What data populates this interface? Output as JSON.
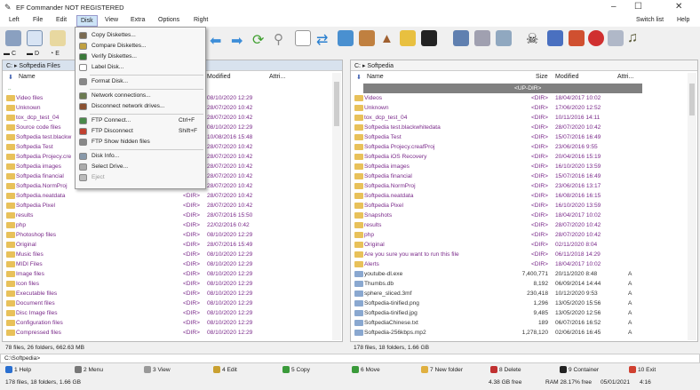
{
  "window": {
    "title": "EF Commander NOT REGISTERED",
    "minimize": "–",
    "maximize": "☐",
    "close": "✕"
  },
  "menubar": {
    "items": [
      "Left",
      "File",
      "Edit",
      "Disk",
      "View",
      "Extra",
      "Options",
      "Right"
    ],
    "switch_list": "Switch list",
    "help": "Help"
  },
  "drives": [
    "C",
    "D",
    "E"
  ],
  "disk_menu": [
    {
      "label": "Copy Diskettes...",
      "disabled": false
    },
    {
      "label": "Compare Diskettes...",
      "disabled": false
    },
    {
      "label": "Verify Diskettes...",
      "disabled": false
    },
    {
      "label": "Label Disk...",
      "disabled": false
    },
    {
      "label": "Format Disk...",
      "disabled": false,
      "sep_before": true
    },
    {
      "label": "Network connections...",
      "disabled": false,
      "sep_before": true
    },
    {
      "label": "Disconnect network drives...",
      "disabled": false
    },
    {
      "label": "FTP Connect...",
      "shortcut": "Ctrl+F",
      "disabled": false,
      "sep_before": true
    },
    {
      "label": "FTP Disconnect",
      "shortcut": "Shift+F",
      "disabled": false
    },
    {
      "label": "FTP Show hidden files",
      "disabled": false
    },
    {
      "label": "Disk Info...",
      "disabled": false,
      "sep_before": true
    },
    {
      "label": "Select Drive...",
      "disabled": false
    },
    {
      "label": "Eject",
      "disabled": true
    }
  ],
  "left_pane": {
    "path": "C: ▸ Softpedia Files",
    "columns": {
      "name": "Name",
      "modified": "Modified",
      "attr": "Attri..."
    },
    "parent": "..",
    "rows": [
      [
        "Video files",
        "",
        "08/10/2020 12:29"
      ],
      [
        "Unknown",
        "",
        "28/07/2020 10:42"
      ],
      [
        "tox_dcp_test_04",
        "",
        "28/07/2020 10:42"
      ],
      [
        "Source code files",
        "",
        "08/10/2020 12:29"
      ],
      [
        "Softpedia test.blackw",
        "",
        "10/08/2016 15:48"
      ],
      [
        "Softpedia Test",
        "",
        "28/07/2020 10:42"
      ],
      [
        "Softpedia Projecy.cre",
        "",
        "28/07/2020 10:42"
      ],
      [
        "Softpedia images",
        "",
        "28/07/2020 10:42"
      ],
      [
        "Softpedia financial",
        "",
        "28/07/2020 10:42"
      ],
      [
        "Softpedia.NormProj",
        "",
        "28/07/2020 10:42"
      ],
      [
        "Softpedia.neatdata",
        "<DIR>",
        "28/07/2020 10:42"
      ],
      [
        "Softpedia Pixel",
        "<DIR>",
        "28/07/2020 10:42"
      ],
      [
        "results",
        "<DIR>",
        "28/07/2016 15:50"
      ],
      [
        "php",
        "<DIR>",
        "22/02/2016 0:42"
      ],
      [
        "Photoshop files",
        "<DIR>",
        "08/10/2020 12:29"
      ],
      [
        "Original",
        "<DIR>",
        "28/07/2016 15:49"
      ],
      [
        "Music files",
        "<DIR>",
        "08/10/2020 12:29"
      ],
      [
        "MIDI Files",
        "<DIR>",
        "08/10/2020 12:29"
      ],
      [
        "Image files",
        "<DIR>",
        "08/10/2020 12:29"
      ],
      [
        "Icon files",
        "<DIR>",
        "08/10/2020 12:29"
      ],
      [
        "Executable files",
        "<DIR>",
        "08/10/2020 12:29"
      ],
      [
        "Document files",
        "<DIR>",
        "08/10/2020 12:29"
      ],
      [
        "Disc Image files",
        "<DIR>",
        "08/10/2020 12:29"
      ],
      [
        "Configuration files",
        "<DIR>",
        "08/10/2020 12:29"
      ],
      [
        "Compressed files",
        "<DIR>",
        "08/10/2020 12:29"
      ]
    ],
    "status": "78 files, 26 folders, 662.63 MB"
  },
  "right_pane": {
    "path": "C: ▸ Softpedia",
    "columns": {
      "name": "Name",
      "size": "Size",
      "modified": "Modified",
      "attr": "Attri..."
    },
    "updir": "<UP-DIR>",
    "rows": [
      [
        "Videos",
        "<DIR>",
        "18/04/2017 10:02",
        ""
      ],
      [
        "Unknown",
        "<DIR>",
        "17/06/2020 12:52",
        ""
      ],
      [
        "tox_dcp_test_04",
        "<DIR>",
        "10/11/2016 14:11",
        ""
      ],
      [
        "Softpedia test.blackwhitedata",
        "<DIR>",
        "28/07/2020 10:42",
        ""
      ],
      [
        "Softpedia Test",
        "<DIR>",
        "15/07/2016 16:49",
        ""
      ],
      [
        "Softpedia Projecy.creafProj",
        "<DIR>",
        "23/06/2016 9:55",
        ""
      ],
      [
        "Softpedia iOS Recovery",
        "<DIR>",
        "20/04/2016 15:19",
        ""
      ],
      [
        "Softpedia images",
        "<DIR>",
        "16/10/2020 13:59",
        ""
      ],
      [
        "Softpedia financial",
        "<DIR>",
        "15/07/2016 16:49",
        ""
      ],
      [
        "Softpedia.NormProj",
        "<DIR>",
        "23/06/2016 13:17",
        ""
      ],
      [
        "Softpedia.neatdata",
        "<DIR>",
        "16/08/2016 16:15",
        ""
      ],
      [
        "Softpedia Pixel",
        "<DIR>",
        "16/10/2020 13:59",
        ""
      ],
      [
        "Snapshots",
        "<DIR>",
        "18/04/2017 10:02",
        ""
      ],
      [
        "results",
        "<DIR>",
        "28/07/2020 10:42",
        ""
      ],
      [
        "php",
        "<DIR>",
        "28/07/2020 10:42",
        ""
      ],
      [
        "Original",
        "<DIR>",
        "02/11/2020 8:04",
        ""
      ],
      [
        "Are you sure you want to run this file",
        "<DIR>",
        "06/11/2018 14:29",
        ""
      ],
      [
        "Alerts",
        "<DIR>",
        "18/04/2017 10:02",
        ""
      ],
      [
        "youtube-dl.exe",
        "7,400,771",
        "20/11/2020 8:48",
        "A"
      ],
      [
        "Thumbs.db",
        "8,192",
        "06/09/2014 14:44",
        "A"
      ],
      [
        "sphere_sliced.3mf",
        "230,418",
        "10/12/2020 9:53",
        "A"
      ],
      [
        "Softpedia-tinified.png",
        "1,296",
        "13/05/2020 15:56",
        "A"
      ],
      [
        "Softpedia-tinified.jpg",
        "9,485",
        "13/05/2020 12:56",
        "A"
      ],
      [
        "SoftpediaChinese.txt",
        "189",
        "06/07/2016 16:52",
        "A"
      ],
      [
        "Softpedia-256kbps.mp2",
        "1,278,120",
        "02/06/2016 16:45",
        "A"
      ]
    ],
    "status": "178 files, 18 folders, 1.66 GB"
  },
  "command_path": "C:\\Softpedia>",
  "fkeys": [
    {
      "label": "1 Help",
      "color": "#2a6fd0"
    },
    {
      "label": "2 Menu",
      "color": "#777"
    },
    {
      "label": "3 View",
      "color": "#999"
    },
    {
      "label": "4 Edit",
      "color": "#c9a030"
    },
    {
      "label": "5 Copy",
      "color": "#3a9a3a"
    },
    {
      "label": "6 Move",
      "color": "#3a9a3a"
    },
    {
      "label": "7 New folder",
      "color": "#e0b040"
    },
    {
      "label": "8 Delete",
      "color": "#c03030"
    },
    {
      "label": "9 Container",
      "color": "#222"
    },
    {
      "label": "10 Exit",
      "color": "#d04030"
    }
  ],
  "bottom": {
    "left": "178 files, 18 folders, 1.66 GB",
    "free": "4.38 GB free",
    "ram": "RAM 28.17% free",
    "date": "05/01/2021",
    "time": "4:16"
  },
  "colors": {
    "folder_text": "#7a2a8a",
    "updir_bar": "#808080",
    "selected_menu": "#cde4f7"
  }
}
